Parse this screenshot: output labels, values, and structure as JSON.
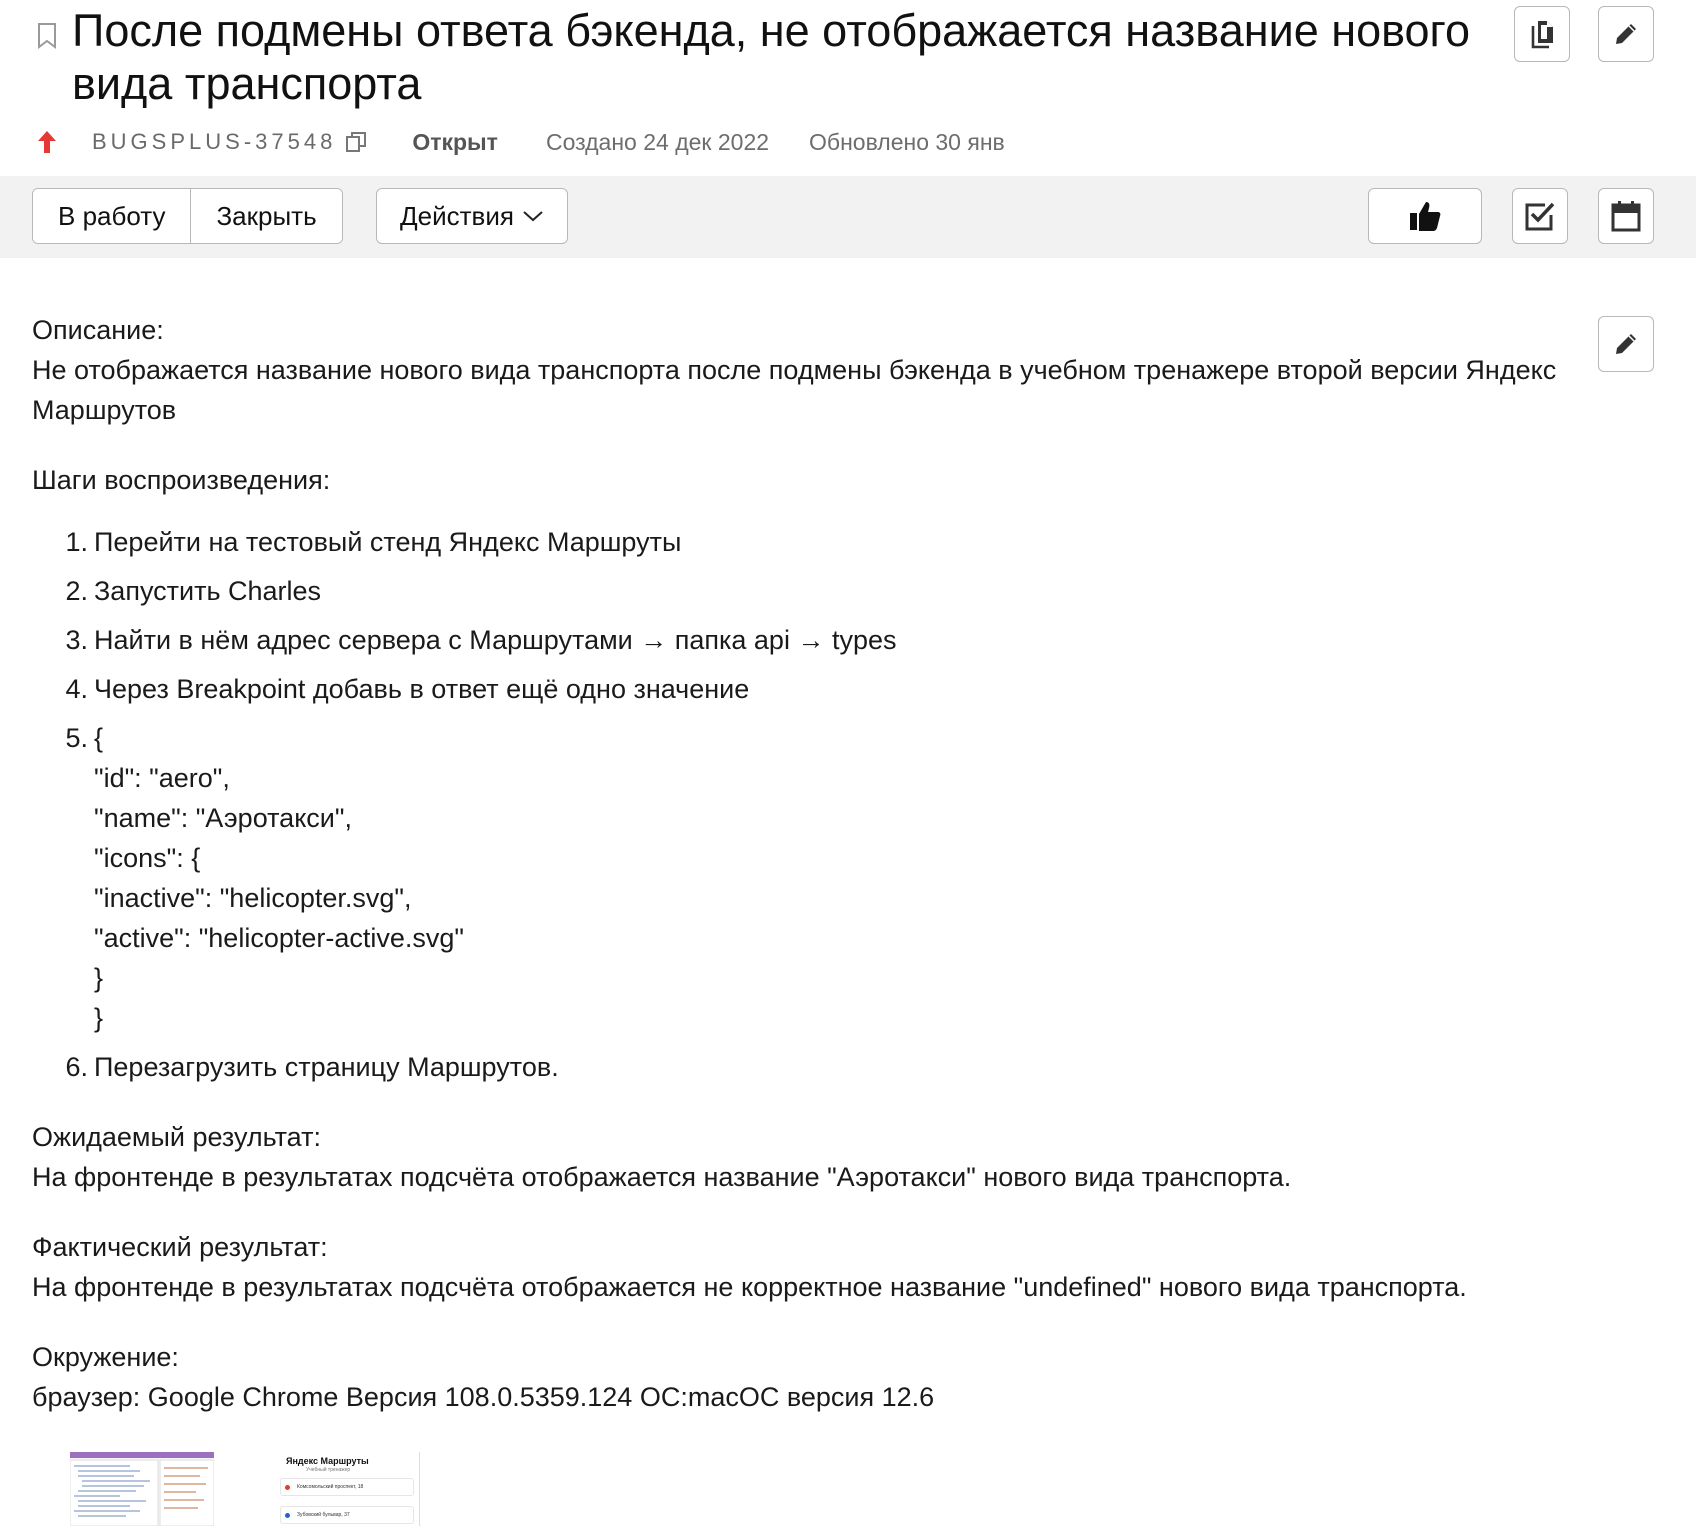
{
  "issue": {
    "title": "После подмены ответа бэкенда, не отображается название нового вида транспорта",
    "key": "BUGSPLUS-37548",
    "status": "Открыт",
    "created": "Создано 24 дек 2022",
    "updated": "Обновлено 30 янв"
  },
  "header_icons": [
    "bookmark-icon",
    "copy-icon",
    "pencil-icon"
  ],
  "toolbar": {
    "in_work_label": "В работу",
    "close_label": "Закрыть",
    "actions_label": "Действия",
    "icons": [
      "thumbs-up-icon",
      "checkbox-icon",
      "calendar-icon"
    ]
  },
  "description": {
    "desc_label": "Описание:",
    "desc_text": "Не отображается название нового вида транспорта после подмены бэкенда в учебном тренажере второй версии Яндекс Маршрутов",
    "steps_label": "Шаги воспроизведения:",
    "steps": [
      {
        "num": "1.",
        "text": "Перейти на тестовый стенд Яндекс Маршруты"
      },
      {
        "num": "2.",
        "text": "Запустить Charles"
      },
      {
        "num": "3.",
        "text": "Найти в нём адрес сервера с Маршрутами → папка api → types"
      },
      {
        "num": "4.",
        "text": "Через Breakpoint добавь в ответ ещё одно значение"
      },
      {
        "num": "5.",
        "lines": [
          "{",
          "\"id\": \"aero\",",
          "\"name\": \"Аэротакси\",",
          "\"icons\": {",
          "\"inactive\": \"helicopter.svg\",",
          "\"active\": \"helicopter-active.svg\"",
          "}",
          "}"
        ]
      },
      {
        "num": "6.",
        "text": "Перезагрузить страницу Маршрутов."
      }
    ],
    "expected_label": "Ожидаемый результат:",
    "expected_text": "На фронтенде в результатах подсчёта отображается название \"Аэротакси\" нового вида транспорта.",
    "actual_label": "Фактический результат:",
    "actual_text": "На фронтенде в результатах подсчёта отображается не корректное название \"undefined\" нового вида транспорта.",
    "env_label": "Окружение:",
    "env_text": "браузер: Google Chrome Версия 108.0.5359.124 ОС:macOC версия 12.6"
  },
  "attachments": {
    "thumb2_title": "Яндекс Маршруты",
    "thumb2_subtitle": "Учебный тренажер",
    "thumb2_from": "Комсомольский проспект, 18",
    "thumb2_to": "Зубовский бульвар, 37"
  },
  "colors": {
    "priority": "#e53935",
    "toolbar_bg": "#f2f2f2",
    "border": "#b8b8b8"
  }
}
